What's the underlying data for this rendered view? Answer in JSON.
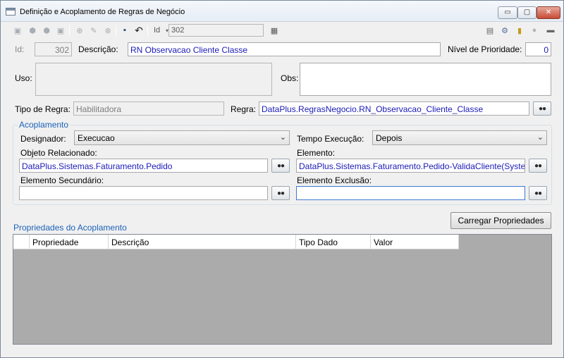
{
  "window": {
    "title": "Definição e Acoplamento de Regras de Negócio",
    "controls": {
      "min": "▭",
      "max": "▢",
      "close": "✕"
    }
  },
  "toolbar": {
    "id_label": "Id",
    "id_value": "302",
    "icons": [
      "first-icon",
      "previous-icon",
      "next-icon",
      "last-icon",
      "new-icon",
      "edit-icon",
      "delete-icon",
      "save-icon",
      "undo-icon",
      "grid-icon",
      "report-icon",
      "tools-icon",
      "note-icon",
      "user-icon",
      "options-icon"
    ]
  },
  "form": {
    "id_label": "Id:",
    "id_value": "302",
    "descricao_label": "Descrição:",
    "descricao_value": "RN Observacao Cliente Classe",
    "prioridade_label": "Nível de Prioridade:",
    "prioridade_value": "0",
    "uso_label": "Uso:",
    "uso_value": "",
    "obs_label": "Obs:",
    "obs_value": "",
    "tipo_label": "Tipo de Regra:",
    "tipo_value": "Habilitadora",
    "regra_label": "Regra:",
    "regra_value": "DataPlus.RegrasNegocio.RN_Observacao_Cliente_Classe"
  },
  "acoplamento": {
    "title": "Acoplamento",
    "designador_label": "Designador:",
    "designador_value": "Execucao",
    "tempo_label": "Tempo Execução:",
    "tempo_value": "Depois",
    "objeto_label": "Objeto Relacionado:",
    "objeto_value": "DataPlus.Sistemas.Faturamento.Pedido",
    "elemento_label": "Elemento:",
    "elemento_value": "DataPlus.Sistemas.Faturamento.Pedido-ValidaCliente(Syste",
    "secundario_label": "Elemento Secundário:",
    "secundario_value": "",
    "exclusao_label": "Elemento Exclusão:",
    "exclusao_value": ""
  },
  "propriedades": {
    "title": "Propriedades do Acoplamento",
    "load_button": "Carregar Propriedades",
    "columns": [
      "Propriedade",
      "Descrição",
      "Tipo Dado",
      "Valor"
    ]
  }
}
